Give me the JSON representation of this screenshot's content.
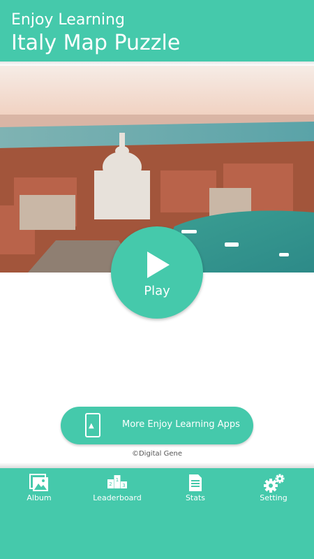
{
  "header": {
    "subtitle": "Enjoy Learning",
    "title": "Italy Map Puzzle"
  },
  "hero": {
    "image": "venice-aerial-photo"
  },
  "play_button": {
    "label": "Play",
    "icon": "play-icon"
  },
  "more_apps_button": {
    "label": "More Enjoy Learning Apps",
    "icon": "phone-book-icon"
  },
  "copyright": "©Digital Gene",
  "bottom_nav": {
    "items": [
      {
        "label": "Album",
        "icon": "album-icon"
      },
      {
        "label": "Leaderboard",
        "icon": "podium-icon"
      },
      {
        "label": "Stats",
        "icon": "document-icon"
      },
      {
        "label": "Setting",
        "icon": "gears-icon"
      }
    ]
  },
  "colors": {
    "accent": "#45c9ab",
    "text_on_accent": "#ffffff"
  }
}
